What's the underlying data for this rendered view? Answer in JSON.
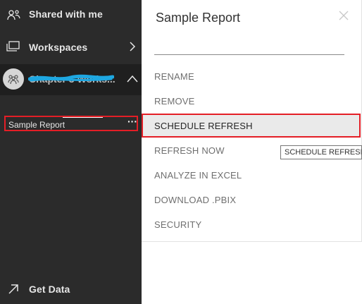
{
  "nav": {
    "shared_label": "Shared with me",
    "workspaces_label": "Workspaces",
    "workspace_name": "Chapter 3 Works...",
    "report_label": "Sample Report",
    "getdata_label": "Get Data",
    "shared_icon": "people-share-icon",
    "workspaces_icon": "workspaces-icon",
    "getdata_icon": "arrow-up-right-icon"
  },
  "panel": {
    "title": "Sample Report",
    "items": [
      {
        "label": "RENAME"
      },
      {
        "label": "REMOVE"
      },
      {
        "label": "SCHEDULE REFRESH"
      },
      {
        "label": "REFRESH NOW"
      },
      {
        "label": "ANALYZE IN EXCEL"
      },
      {
        "label": "DOWNLOAD .PBIX"
      },
      {
        "label": "SECURITY"
      }
    ],
    "tooltip": "SCHEDULE REFRESH"
  },
  "colors": {
    "nav_bg": "#2b2b2b",
    "highlight_border": "#e41e26",
    "scribble": "#1ea7e1"
  }
}
